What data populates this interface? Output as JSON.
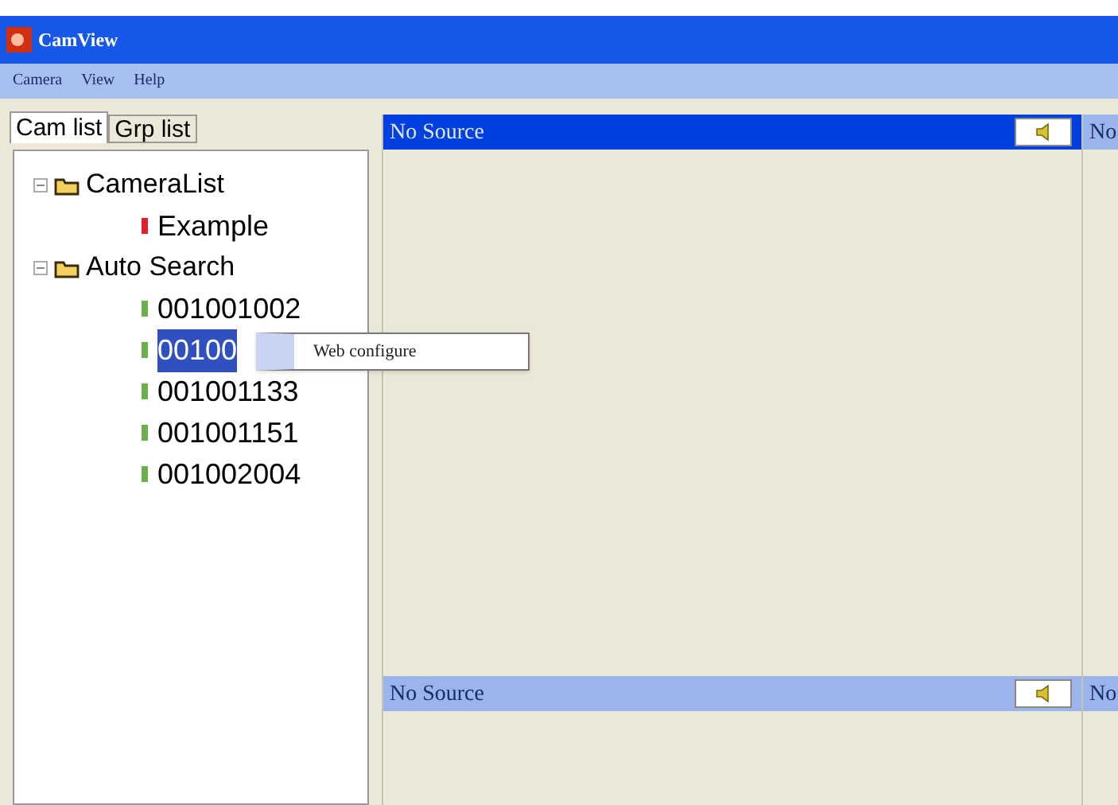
{
  "window": {
    "title": "CamView"
  },
  "menu": [
    "Camera",
    "View",
    "Help"
  ],
  "tabs": [
    {
      "label": "Cam list",
      "selected": true
    },
    {
      "label": "Grp list",
      "selected": false
    }
  ],
  "tree": [
    {
      "label": "CameraList",
      "expanded": true,
      "children": [
        {
          "label": "Example",
          "color": "#e0202a",
          "selected": false
        }
      ]
    },
    {
      "label": "Auto Search",
      "expanded": true,
      "children": [
        {
          "label": "001001002",
          "color": "#6cb04a",
          "selected": false
        },
        {
          "label": "00100",
          "color": "#6cb04a",
          "selected": true
        },
        {
          "label": "001001133",
          "color": "#6cb04a",
          "selected": false
        },
        {
          "label": "001001151",
          "color": "#6cb04a",
          "selected": false
        },
        {
          "label": "001002004",
          "color": "#6cb04a",
          "selected": false
        }
      ]
    }
  ],
  "context_menu": [
    "Web configure"
  ],
  "panes": [
    {
      "title": "No Source",
      "selected": true
    },
    {
      "title": "No",
      "selected": false
    },
    {
      "title": "No Source",
      "selected": false
    },
    {
      "title": "No",
      "selected": false
    }
  ]
}
